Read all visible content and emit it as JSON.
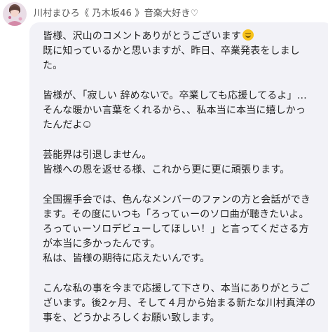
{
  "sender": {
    "name": "川村まひろ《 乃木坂46 》音楽大好き♡"
  },
  "message": {
    "p1": {
      "l1": "皆様、沢山のコメントありがとうございます",
      "l2": "既に知っているかと思いますが、昨日、卒業発表をしまし",
      "l3": "た。"
    },
    "p2": {
      "l1": "皆様が、「寂しい 辞めないで。卒業しても応援してるよ」…",
      "l2": "そんな暖かい言葉をくれるから、、私本当に本当に嬉しかっ",
      "l3": "たんだよ"
    },
    "p3": {
      "l1": "芸能界は引退しません。",
      "l2": "皆様への恩を返せる様、これから更に更に頑張ります。"
    },
    "p4": {
      "l1": "全国握手会では、色んなメンバーのファンの方と会話ができ",
      "l2": "ます。その度にいつも「ろってぃーのソロ曲が聴きたいよ。",
      "l3": "ろってぃーソロデビューしてほしい！」と言ってくださる方",
      "l4": "が本当に多かったんです。",
      "l5": "私は、皆様の期待に応えたいんです。"
    },
    "p5": {
      "l1": "こんな私の事を今まで応援して下さり、本当にありがとうご",
      "l2": "ざいます。後2ヶ月、そして４月から始まる新たな川村真洋の",
      "l3": "事を、どうかよろしくお願い致します。"
    }
  },
  "icons": {
    "smile_emoji": "grinning-face-emoji",
    "small_emoji": "smiling-face-emoji"
  },
  "colors": {
    "bubble_bg": "#f2f2f7",
    "emoji_yellow": "#f7c21a"
  }
}
